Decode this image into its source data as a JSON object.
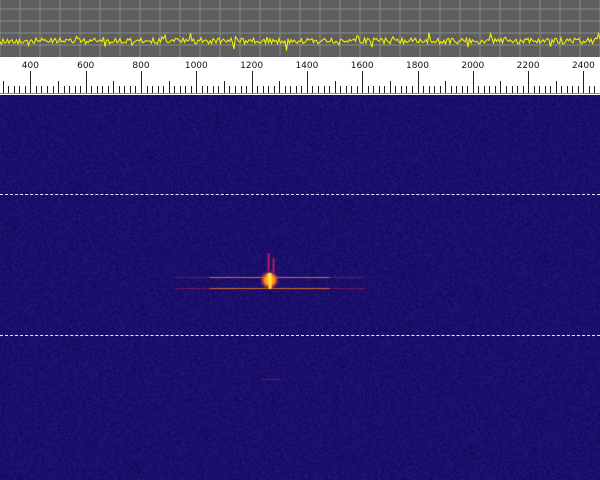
{
  "colors": {
    "spectrum_background": "#5e5e5e",
    "spectrum_grid": "#8a8a8a",
    "spectrum_trace": "#f0f000",
    "scale_background": "#ffffff",
    "scale_ticks": "#222222",
    "waterfall_background": "#160f63",
    "signal_core": "#ffe040",
    "signal_mid": "#ff7a1a",
    "signal_low": "#b02060",
    "marker_line": "#e8e8ff"
  },
  "scale": {
    "ticks": [
      {
        "value": 400,
        "label": "400"
      },
      {
        "value": 600,
        "label": "600"
      },
      {
        "value": 800,
        "label": "800"
      },
      {
        "value": 1000,
        "label": "1000"
      },
      {
        "value": 1200,
        "label": "1200"
      },
      {
        "value": 1400,
        "label": "1400"
      },
      {
        "value": 1600,
        "label": "1600"
      },
      {
        "value": 1800,
        "label": "1800"
      },
      {
        "value": 2000,
        "label": "2000"
      },
      {
        "value": 2200,
        "label": "2200"
      },
      {
        "value": 2400,
        "label": "2400"
      }
    ],
    "range": [
      290,
      2460
    ]
  },
  "waterfall": {
    "signal_frequency": 1265,
    "faint_trace_frequency": 1265
  }
}
